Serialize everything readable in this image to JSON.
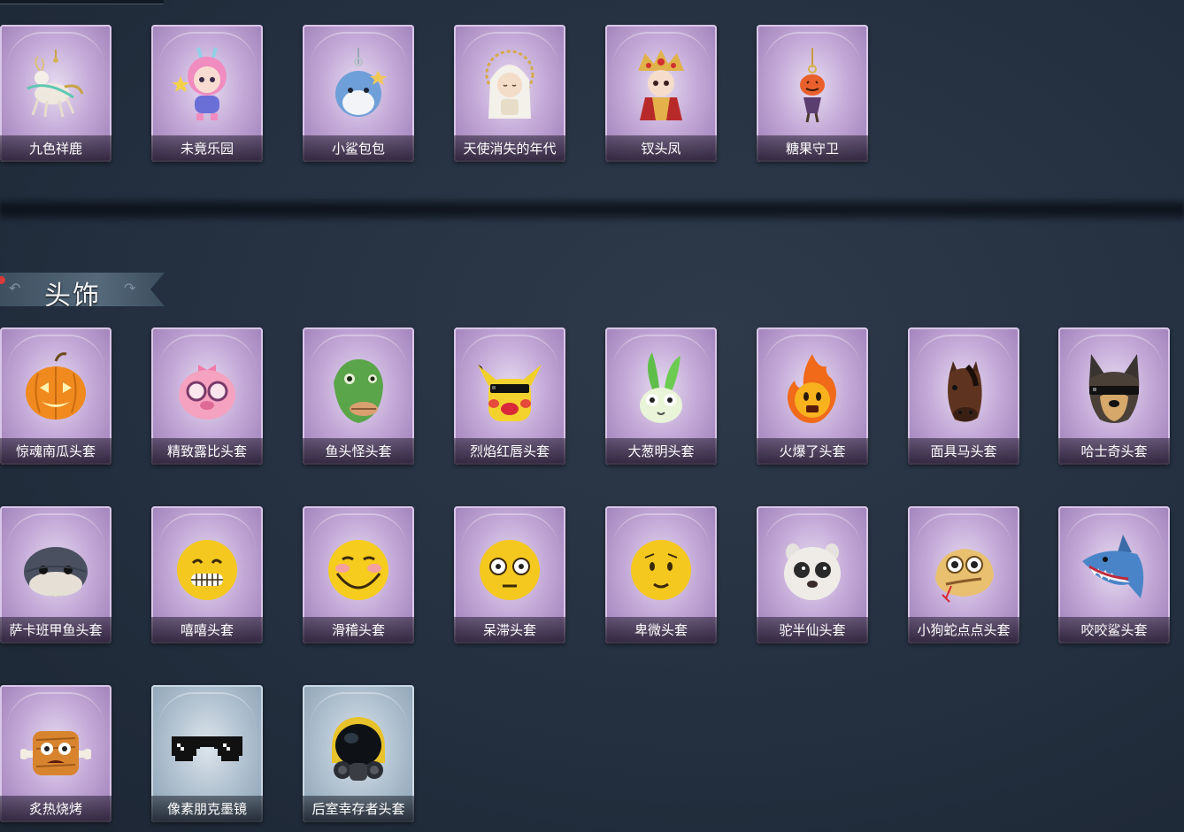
{
  "section_title": "头饰",
  "top_row": [
    {
      "name": "九色祥鹿",
      "icon": "deer-charm-icon"
    },
    {
      "name": "未竟乐园",
      "icon": "pink-doll-icon"
    },
    {
      "name": "小鲨包包",
      "icon": "shark-pendant-icon"
    },
    {
      "name": "天使消失的年代",
      "icon": "angel-doll-icon"
    },
    {
      "name": "钗头凤",
      "icon": "phoenix-crown-doll-icon"
    },
    {
      "name": "糖果守卫",
      "icon": "candy-guard-icon"
    }
  ],
  "headwear_row1": [
    {
      "name": "惊魂南瓜头套",
      "icon": "pumpkin-head-icon"
    },
    {
      "name": "精致露比头套",
      "icon": "pink-pig-head-icon"
    },
    {
      "name": "鱼头怪头套",
      "icon": "fish-head-icon"
    },
    {
      "name": "烈焰红唇头套",
      "icon": "yellow-mouse-head-icon"
    },
    {
      "name": "大葱明头套",
      "icon": "green-onion-head-icon"
    },
    {
      "name": "火爆了头套",
      "icon": "fire-spirit-head-icon"
    },
    {
      "name": "面具马头套",
      "icon": "horse-mask-icon"
    },
    {
      "name": "哈士奇头套",
      "icon": "husky-head-icon"
    }
  ],
  "headwear_row2": [
    {
      "name": "萨卡班甲鱼头套",
      "icon": "armored-fish-head-icon"
    },
    {
      "name": "嘻嘻头套",
      "icon": "grin-emoji-head-icon"
    },
    {
      "name": "滑稽头套",
      "icon": "funny-emoji-head-icon"
    },
    {
      "name": "呆滞头套",
      "icon": "dazed-emoji-head-icon"
    },
    {
      "name": "卑微头套",
      "icon": "humble-emoji-head-icon"
    },
    {
      "name": "驼半仙头套",
      "icon": "alpaca-head-icon"
    },
    {
      "name": "小狗蛇点点头套",
      "icon": "snake-head-icon"
    },
    {
      "name": "咬咬鲨头套",
      "icon": "shark-head-icon"
    }
  ],
  "headwear_row3": [
    {
      "name": "炙热烧烤",
      "icon": "grilled-meat-head-icon",
      "rarity": "purple"
    },
    {
      "name": "像素朋克墨镜",
      "icon": "pixel-sunglasses-icon",
      "rarity": "blue"
    },
    {
      "name": "后室幸存者头套",
      "icon": "gas-mask-helmet-icon",
      "rarity": "blue"
    }
  ]
}
